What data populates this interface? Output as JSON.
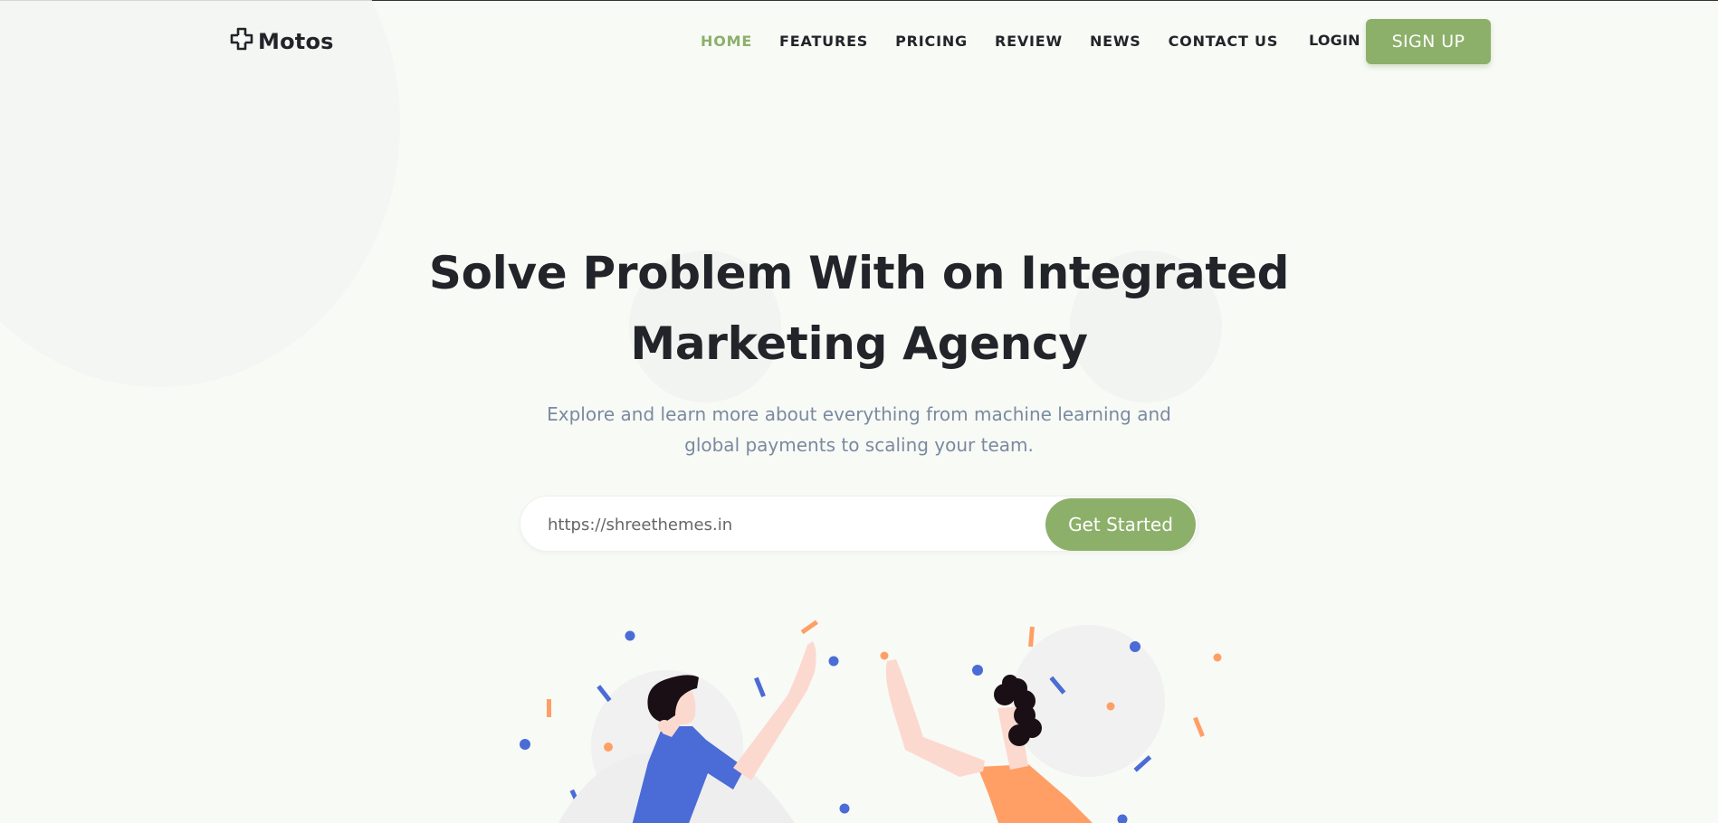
{
  "brand": {
    "name": "Motos"
  },
  "nav": {
    "items": [
      {
        "label": "HOME",
        "active": true
      },
      {
        "label": "FEATURES"
      },
      {
        "label": "PRICING"
      },
      {
        "label": "REVIEW"
      },
      {
        "label": "NEWS"
      },
      {
        "label": "CONTACT US"
      }
    ],
    "login_label": "LOGIN",
    "signup_label": "SIGN UP"
  },
  "hero": {
    "title_line1": "Solve Problem With on Integrated",
    "title_line2": "Marketing Agency",
    "subtitle_line1": "Explore and learn more about everything from machine learning and",
    "subtitle_line2": "global payments to scaling your team.",
    "input_placeholder": "https://shreethemes.in",
    "cta_label": "Get Started"
  },
  "colors": {
    "accent": "#8cb06a",
    "background": "#f8faf6",
    "text": "#212529",
    "muted": "#7a8aa0",
    "illustration_blue": "#4b6bd6",
    "illustration_orange": "#ff9f66",
    "skin": "#fcd9cf"
  },
  "icons": {
    "logo": "motos-cross-logo-icon"
  }
}
